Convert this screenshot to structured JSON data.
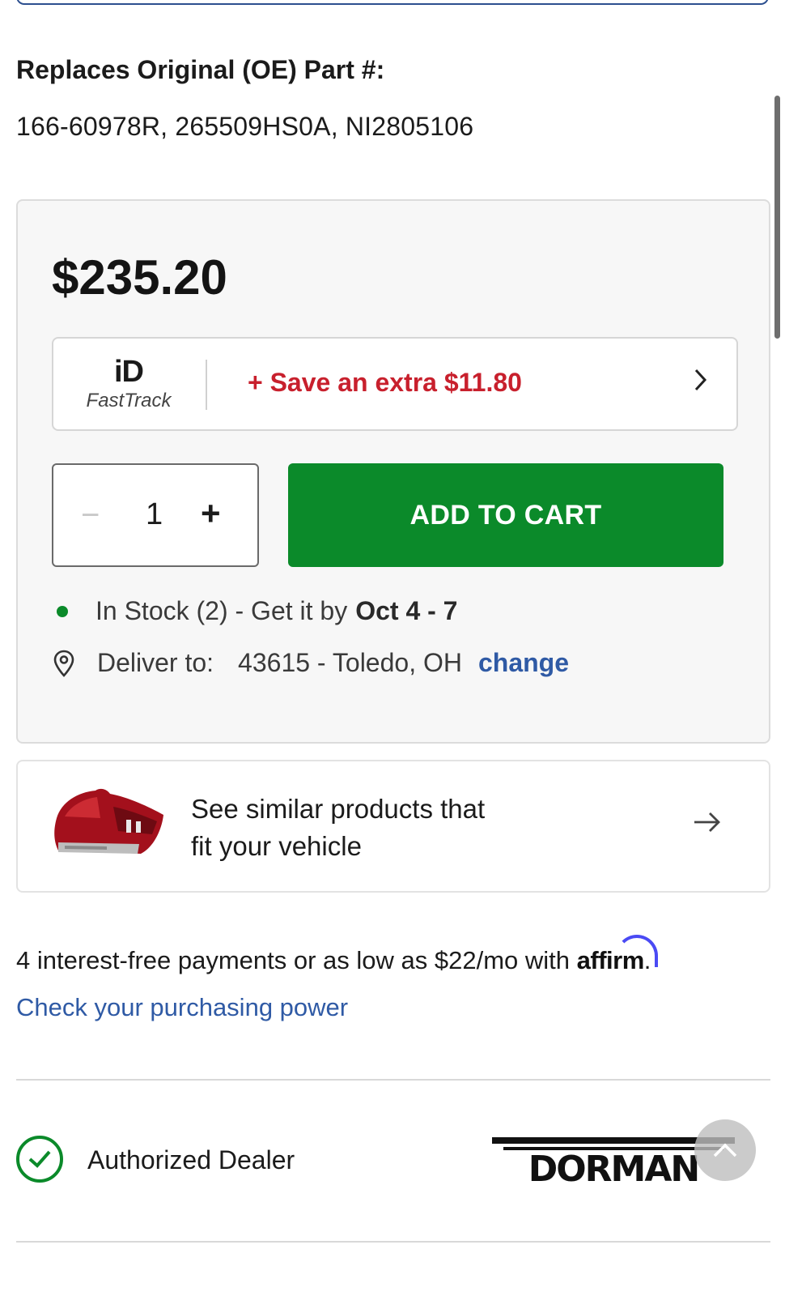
{
  "oe": {
    "title": "Replaces Original (OE) Part #:",
    "numbers": "166-60978R, 265509HS0A, NI2805106"
  },
  "price_card": {
    "price": "$235.20",
    "fasttrack": {
      "logo_id": "iD",
      "logo_text": "FastTrack",
      "promo": "+ Save an extra $11.80",
      "chevron_icon": "chevron-right-icon"
    },
    "quantity": {
      "minus": "−",
      "value": "1",
      "plus": "+"
    },
    "add_to_cart_label": "ADD TO CART",
    "stock": {
      "text": "In Stock (2) - Get it by",
      "date": "Oct 4 - 7"
    },
    "delivery": {
      "label": "Deliver to:",
      "location": "43615 - Toledo, OH",
      "change_label": "change"
    }
  },
  "similar": {
    "line1": "See similar products that",
    "line2": "fit your vehicle",
    "arrow": "→"
  },
  "affirm": {
    "text_before": "4 interest-free payments or as low as $22/mo with ",
    "brand": "affirm",
    "text_after": ".",
    "link": "Check your purchasing power"
  },
  "dealer": {
    "label": "Authorized Dealer",
    "brand_logo": "DORMAN"
  },
  "colors": {
    "accent_green": "#0b8a2a",
    "promo_red": "#c8202d",
    "link_blue": "#2f5aa5",
    "affirm_blue": "#4a4af4"
  }
}
